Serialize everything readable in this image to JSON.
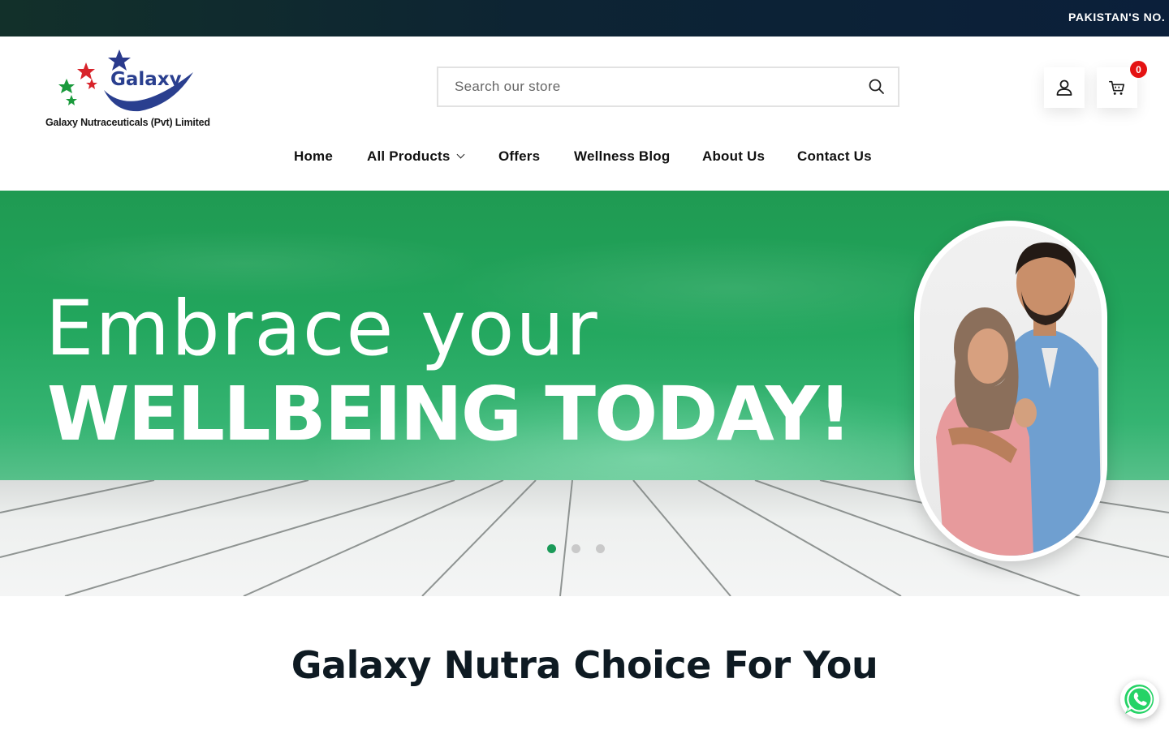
{
  "announcement": {
    "text": "PAKISTAN'S NO."
  },
  "logo": {
    "brand": "Galaxy",
    "company": "Galaxy Nutraceuticals (Pvt) Limited"
  },
  "search": {
    "placeholder": "Search our store",
    "value": ""
  },
  "header_actions": {
    "account_icon": "user-icon",
    "cart_icon": "cart-icon",
    "cart_count": "0"
  },
  "nav": {
    "items": [
      {
        "label": "Home"
      },
      {
        "label": "All Products",
        "has_dropdown": true
      },
      {
        "label": "Offers"
      },
      {
        "label": "Wellness Blog"
      },
      {
        "label": "About Us"
      },
      {
        "label": "Contact Us"
      }
    ]
  },
  "hero": {
    "line1": "Embrace your",
    "line2": "WELLBEING TODAY!",
    "slides_total": 3,
    "active_slide": 1
  },
  "section": {
    "title": "Galaxy Nutra Choice For You"
  },
  "floating": {
    "whatsapp_icon": "whatsapp-icon"
  },
  "colors": {
    "accent_green": "#1a9a58",
    "badge_red": "#e41212",
    "topbar_navy": "#0b1f3a",
    "logo_blue": "#2a3f8f"
  }
}
